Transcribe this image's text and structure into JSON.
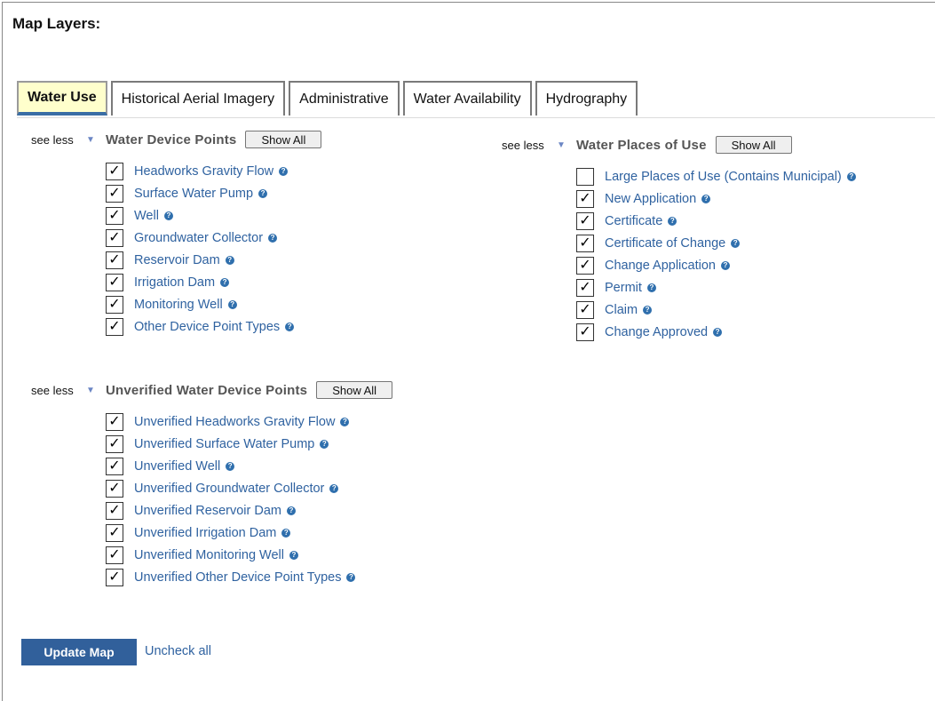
{
  "title": "Map Layers:",
  "tabs": [
    "Water Use",
    "Historical Aerial Imagery",
    "Administrative",
    "Water Availability",
    "Hydrography"
  ],
  "active_tab": "Water Use",
  "help_glyph": "?",
  "check_glyph": "✓",
  "groups": {
    "device_points": {
      "see_less": "see less",
      "caret": "▼",
      "title": "Water Device Points",
      "show_all": "Show All",
      "items": [
        {
          "label": "Headworks Gravity Flow",
          "checked": true
        },
        {
          "label": "Surface Water Pump",
          "checked": true
        },
        {
          "label": "Well",
          "checked": true
        },
        {
          "label": "Groundwater Collector",
          "checked": true
        },
        {
          "label": "Reservoir Dam",
          "checked": true
        },
        {
          "label": "Irrigation Dam",
          "checked": true
        },
        {
          "label": "Monitoring Well",
          "checked": true
        },
        {
          "label": "Other Device Point Types",
          "checked": true
        }
      ]
    },
    "places_of_use": {
      "see_less": "see less",
      "caret": "▼",
      "title": "Water Places of Use",
      "show_all": "Show All",
      "items": [
        {
          "label": "Large Places of Use (Contains Municipal)",
          "checked": false
        },
        {
          "label": "New Application",
          "checked": true
        },
        {
          "label": "Certificate",
          "checked": true
        },
        {
          "label": "Certificate of Change",
          "checked": true
        },
        {
          "label": "Change Application",
          "checked": true
        },
        {
          "label": "Permit",
          "checked": true
        },
        {
          "label": "Claim",
          "checked": true
        },
        {
          "label": "Change Approved",
          "checked": true
        }
      ]
    },
    "unverified": {
      "see_less": "see less",
      "caret": "▼",
      "title": "Unverified Water Device Points",
      "show_all": "Show All",
      "items": [
        {
          "label": "Unverified Headworks Gravity Flow",
          "checked": true
        },
        {
          "label": "Unverified Surface Water Pump",
          "checked": true
        },
        {
          "label": "Unverified Well",
          "checked": true
        },
        {
          "label": "Unverified Groundwater Collector",
          "checked": true
        },
        {
          "label": "Unverified Reservoir Dam",
          "checked": true
        },
        {
          "label": "Unverified Irrigation Dam",
          "checked": true
        },
        {
          "label": "Unverified Monitoring Well",
          "checked": true
        },
        {
          "label": "Unverified Other Device Point Types",
          "checked": true
        }
      ]
    }
  },
  "footer": {
    "update_button": "Update Map",
    "uncheck_all": "Uncheck all"
  },
  "colors": {
    "accent": "#31609b",
    "link": "#2f62a0",
    "active_tab_bg": "#ffffcc"
  }
}
